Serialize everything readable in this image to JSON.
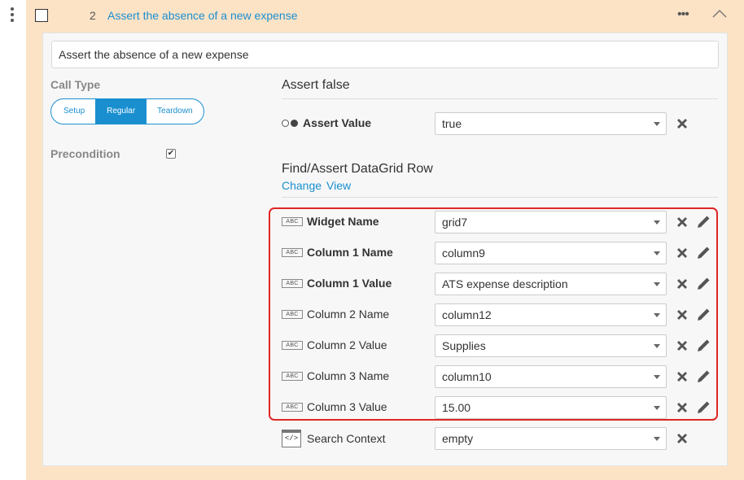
{
  "step": {
    "number": "2",
    "title": "Assert the absence of a new expense",
    "description": "Assert the absence of a new expense"
  },
  "left": {
    "call_type_label": "Call Type",
    "call_type_options": [
      "Setup",
      "Regular",
      "Teardown"
    ],
    "call_type_selected": "Regular",
    "precondition_label": "Precondition",
    "precondition_checked": true,
    "check_glyph": "✔"
  },
  "assert": {
    "heading": "Assert false",
    "value_label": "Assert Value",
    "value": "true"
  },
  "find": {
    "heading": "Find/Assert DataGrid Row",
    "change_link": "Change",
    "view_link": "View"
  },
  "params": [
    {
      "label": "Widget Name",
      "value": "grid7",
      "bold": true
    },
    {
      "label": "Column 1 Name",
      "value": "column9",
      "bold": true
    },
    {
      "label": "Column 1 Value",
      "value": "ATS expense description",
      "bold": true
    },
    {
      "label": "Column 2 Name",
      "value": "column12",
      "bold": false
    },
    {
      "label": "Column 2 Value",
      "value": "Supplies",
      "bold": false
    },
    {
      "label": "Column 3 Name",
      "value": "column10",
      "bold": false
    },
    {
      "label": "Column 3 Value",
      "value": "15.00",
      "bold": false
    }
  ],
  "abc_icon_text": "ABC",
  "search_context": {
    "label": "Search Context",
    "value": "empty",
    "icon_text": "</>"
  },
  "colors": {
    "accent": "#1a8fd0",
    "frame": "#fde3c6",
    "highlight": "#e02626"
  }
}
